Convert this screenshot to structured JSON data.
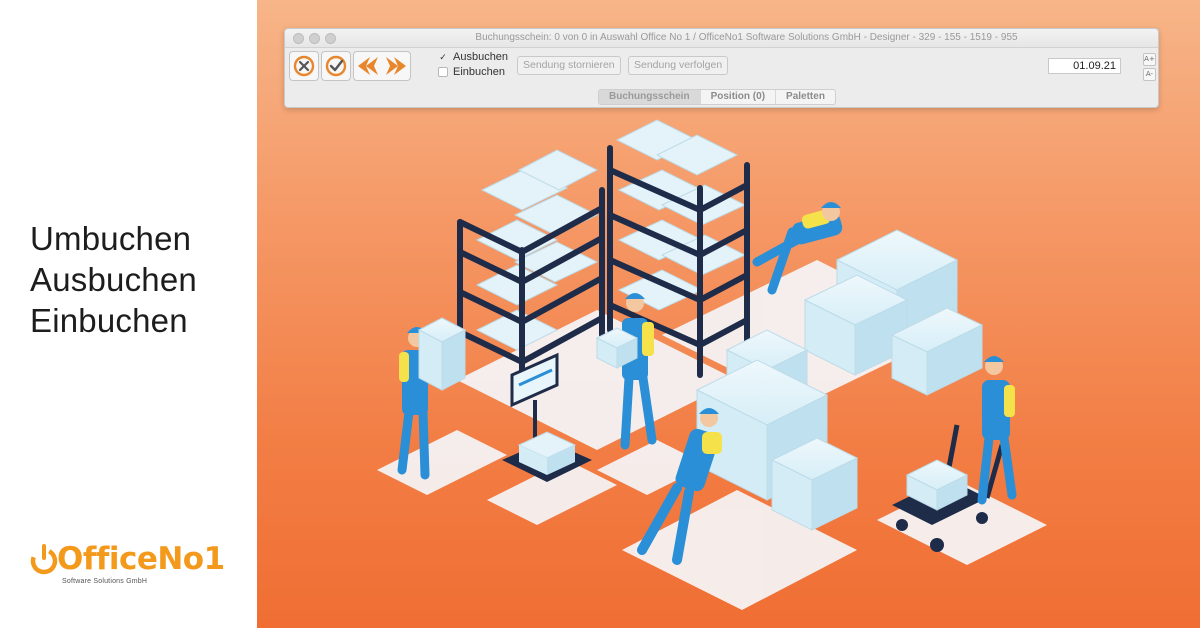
{
  "headline": {
    "line1": "Umbuchen",
    "line2": "Ausbuchen",
    "line3": "Einbuchen"
  },
  "logo": {
    "text": "OfficeNo1",
    "tagline": "Software Solutions GmbH"
  },
  "window": {
    "title": "Buchungsschein: 0 von 0 in Auswahl Office No 1 /  OfficeNo1 Software Solutions GmbH - Designer - 329 - 155 - 1519 - 955"
  },
  "toolbar": {
    "options": [
      {
        "label": "Ausbuchen",
        "checked": true
      },
      {
        "label": "Einbuchen",
        "checked": false
      }
    ],
    "cancel_shipment_label": "Sendung stornieren",
    "track_shipment_label": "Sendung verfolgen",
    "date_value": "01.09.21",
    "font_increase": "A+",
    "font_decrease": "A-"
  },
  "tabs": [
    {
      "label": "Buchungsschein",
      "active": true
    },
    {
      "label": "Position (0)",
      "active": false
    },
    {
      "label": "Paletten",
      "active": false
    }
  ],
  "colors": {
    "accent_orange": "#f39a1c",
    "background_orange": "#f27e45",
    "box_light_blue": "#cfe8f2",
    "shelf_navy": "#1e2c4a",
    "worker_blue": "#2a8fd6",
    "worker_yellow": "#f5e14a"
  },
  "icons": [
    "cancel-icon",
    "confirm-icon",
    "arrow-left-icon",
    "arrow-right-icon"
  ]
}
